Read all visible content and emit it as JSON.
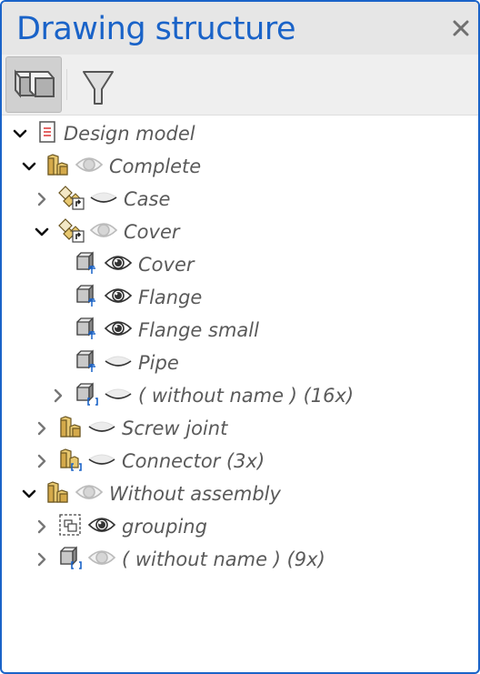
{
  "panel": {
    "title": "Drawing structure",
    "close_icon": "close-icon",
    "accent_color": "#1a63c8"
  },
  "toolbar": {
    "buttons": [
      {
        "icon": "solid-blocks-icon",
        "active": true
      },
      {
        "icon": "filter-funnel-icon",
        "active": false
      }
    ]
  },
  "tree": {
    "nodes": [
      {
        "label": "Design model",
        "level": 0,
        "expander": "expanded",
        "icon": "document-icon",
        "visibility": "none"
      },
      {
        "label": "Complete",
        "level": 1,
        "expander": "expanded",
        "icon": "assembly-icon",
        "visibility": "partial"
      },
      {
        "label": "Case",
        "level": 2,
        "expander": "collapsed",
        "icon": "assembly-reference-icon",
        "visibility": "hidden"
      },
      {
        "label": "Cover",
        "level": 2,
        "expander": "expanded",
        "icon": "assembly-reference-icon",
        "visibility": "partial"
      },
      {
        "label": "Cover",
        "level": 3,
        "expander": "none",
        "icon": "part-with-axis-icon",
        "visibility": "visible"
      },
      {
        "label": "Flange",
        "level": 3,
        "expander": "none",
        "icon": "part-with-axis-icon",
        "visibility": "visible"
      },
      {
        "label": "Flange small",
        "level": 3,
        "expander": "none",
        "icon": "part-with-axis-icon",
        "visibility": "visible"
      },
      {
        "label": "Pipe",
        "level": 3,
        "expander": "none",
        "icon": "part-with-axis-icon",
        "visibility": "hidden"
      },
      {
        "label": "( without name ) (16x)",
        "level": 2.5,
        "expander": "collapsed",
        "icon": "part-group-icon",
        "visibility": "hidden"
      },
      {
        "label": "Screw joint",
        "level": 2,
        "expander": "collapsed",
        "icon": "assembly-icon",
        "visibility": "hidden"
      },
      {
        "label": "Connector (3x)",
        "level": 2,
        "expander": "collapsed",
        "icon": "assembly-group-icon",
        "visibility": "hidden"
      },
      {
        "label": "Without assembly",
        "level": 1,
        "expander": "expanded",
        "icon": "assembly-icon",
        "visibility": "partial"
      },
      {
        "label": "grouping",
        "level": 2,
        "expander": "collapsed",
        "icon": "grouping-icon",
        "visibility": "visible"
      },
      {
        "label": "( without name ) (9x)",
        "level": 2,
        "expander": "collapsed",
        "icon": "part-group-icon",
        "visibility": "partial"
      }
    ]
  }
}
